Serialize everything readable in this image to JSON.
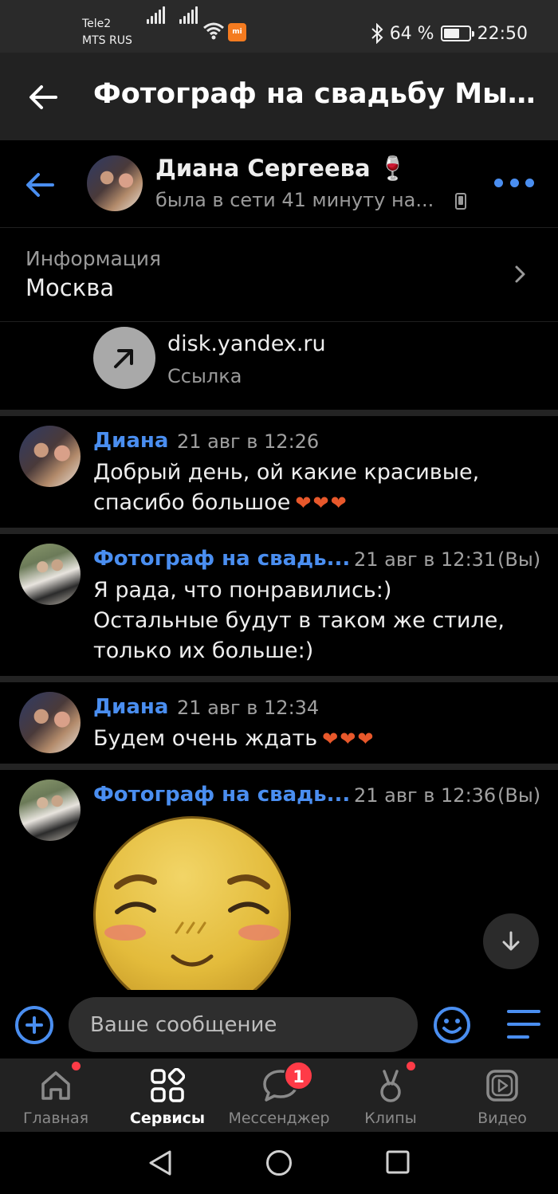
{
  "status_bar": {
    "carrier_line1": "Tele2",
    "carrier_line2": "MTS RUS",
    "mi_badge": "mi",
    "battery_percent": "64 %",
    "battery_level": 0.64,
    "time": "22:50"
  },
  "app_header": {
    "title": "Фотограф на свадьбу Мыти..."
  },
  "chat_header": {
    "name": "Диана Сергеева 🍷",
    "status": "была в сети 41 минуту на..."
  },
  "info": {
    "label": "Информация",
    "value": "Москва"
  },
  "link": {
    "url": "disk.yandex.ru",
    "label": "Ссылка"
  },
  "messages": [
    {
      "sender": "Диана",
      "time": "21 авг в 12:26",
      "lines": [
        "Добрый день, ой какие красивые,",
        "спасибо большое"
      ],
      "hearts": "❤❤❤"
    },
    {
      "sender": "Фотограф на свадь...",
      "time": "21 авг в 12:31",
      "you": "(Вы)",
      "lines": [
        "Я рада, что понравились:)",
        "Остальные будут в таком же стиле,",
        "только их больше:)"
      ]
    },
    {
      "sender": "Диана",
      "time": "21 авг в 12:34",
      "lines": [
        "Будем очень ждать"
      ],
      "hearts": "❤❤❤"
    },
    {
      "sender": "Фотограф на свадь...",
      "time": "21 авг в 12:36",
      "you": "(Вы)",
      "sticker": "blushing-smile-sticker"
    }
  ],
  "composer": {
    "placeholder": "Ваше сообщение"
  },
  "bottom_nav": {
    "items": [
      {
        "label": "Главная",
        "icon": "home-icon",
        "dot": true
      },
      {
        "label": "Сервисы",
        "icon": "services-icon",
        "active": true
      },
      {
        "label": "Мессенджер",
        "icon": "messenger-icon",
        "badge": "1"
      },
      {
        "label": "Клипы",
        "icon": "clips-icon",
        "dot": true
      },
      {
        "label": "Видео",
        "icon": "video-icon"
      }
    ]
  },
  "colors": {
    "accent": "#4a8ef0",
    "background": "#000000",
    "header": "#222222",
    "badge": "#ff3b47"
  }
}
